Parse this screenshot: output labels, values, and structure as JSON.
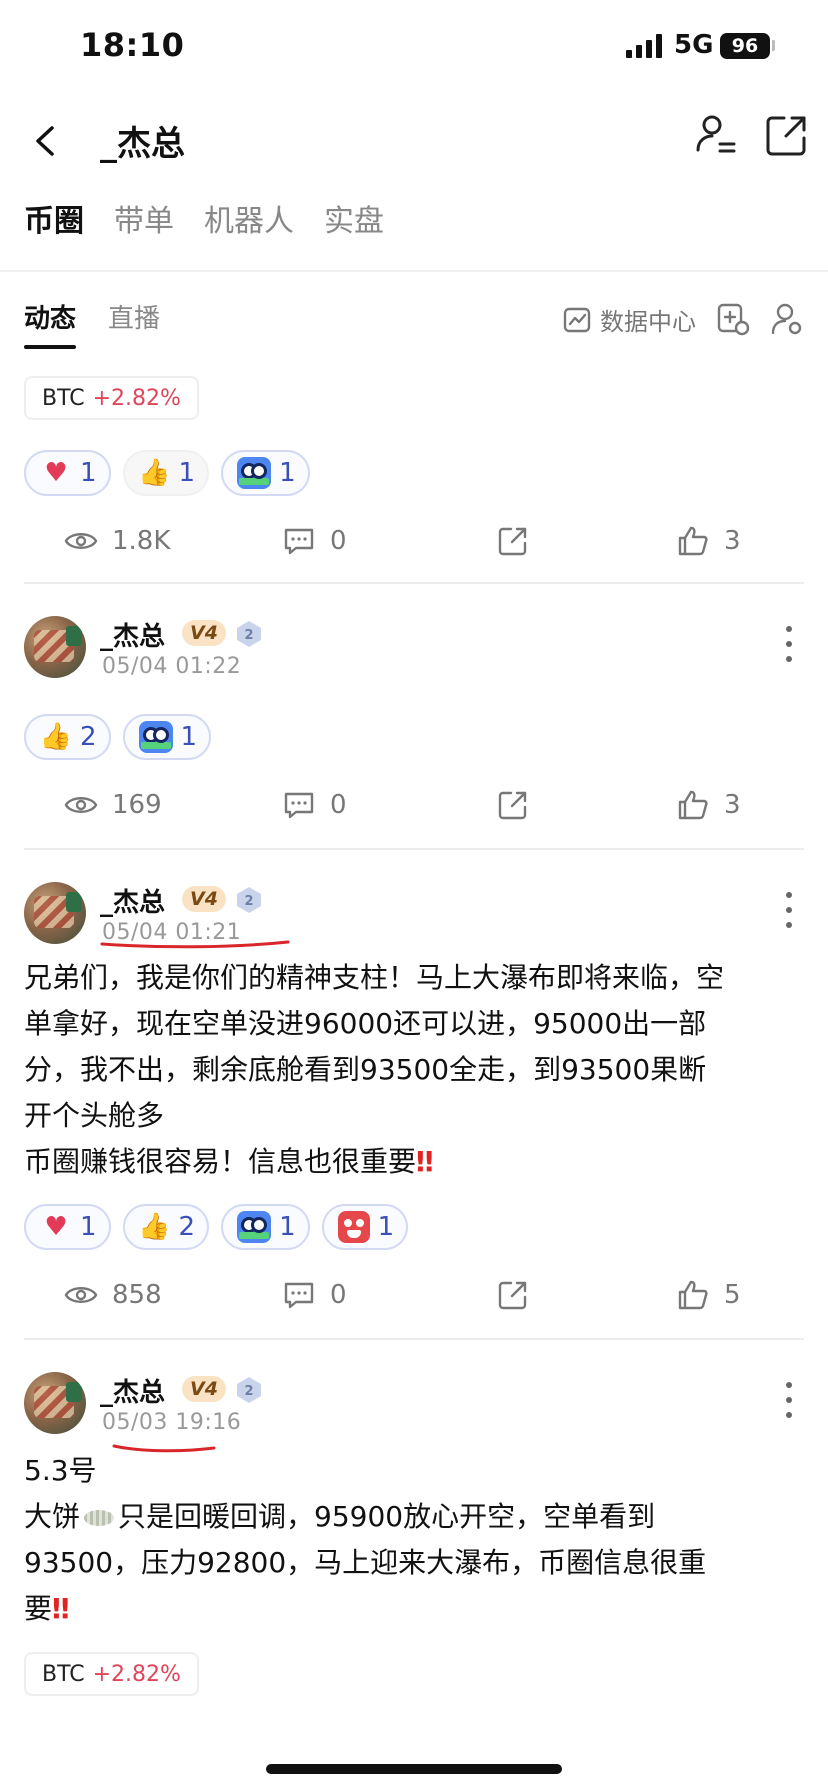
{
  "status_bar": {
    "time": "18:10",
    "network": "5G",
    "battery": "96"
  },
  "nav": {
    "title": "_杰总",
    "back_icon": "chevron-left-icon",
    "user_icon": "user-list-icon",
    "share_icon": "share-out-icon"
  },
  "main_tabs": [
    "币圈",
    "带单",
    "机器人",
    "实盘"
  ],
  "sub_tabs": [
    "动态",
    "直播"
  ],
  "data_center": "数据中心",
  "top_section": {
    "tag": {
      "name": "BTC",
      "change": "+2.82%"
    },
    "reactions": [
      "1",
      "1",
      "1"
    ],
    "stats": {
      "views": "1.8K",
      "comments": "0",
      "likes": "3"
    }
  },
  "posts": [
    {
      "author": "_杰总",
      "vip": "V4",
      "level": "2",
      "time": "05/04 01:22",
      "reactions": [
        "2",
        "1"
      ],
      "stats": {
        "views": "169",
        "comments": "0",
        "likes": "3"
      }
    },
    {
      "author": "_杰总",
      "vip": "V4",
      "level": "2",
      "time": "05/04 01:21",
      "body": [
        "兄弟们，我是你们的精神支柱！马上大瀑布即将来临，空",
        "单拿好，现在空单没进96000还可以进，95000出一部",
        "分，我不出，剩余底舱看到93500全走，到93500果断",
        "开个头舱多",
        "币圈赚钱很容易！信息也很重要"
      ],
      "exclaim": "‼",
      "reactions": [
        "1",
        "2",
        "1",
        "1"
      ],
      "stats": {
        "views": "858",
        "comments": "0",
        "likes": "5"
      }
    },
    {
      "author": "_杰总",
      "vip": "V4",
      "level": "2",
      "time": "05/03 19:16",
      "body_line1": "5.3号",
      "body_line2_a": "大饼",
      "body_line2_b": "只是回暖回调，95900放心开空，空单看到",
      "body_line3": "93500，压力92800，马上迎来大瀑布，币圈信息很重",
      "body_line4": "要",
      "exclaim": "‼",
      "tag": {
        "name": "BTC",
        "change": "+2.82%"
      }
    }
  ],
  "colors": {
    "accent_red": "#e0455a",
    "reaction_border": "#d4d9f3",
    "reaction_count": "#3a4fb8"
  }
}
